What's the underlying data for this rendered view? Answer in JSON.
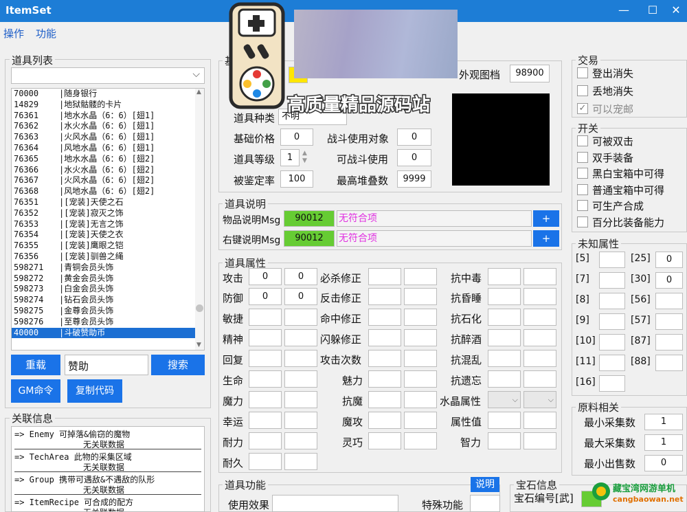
{
  "window": {
    "title": "ItemSet",
    "minimize": "—",
    "maximize": "☐",
    "close": "✕"
  },
  "menu": [
    "操作",
    "功能"
  ],
  "item_list": {
    "title": "道具列表",
    "items": [
      {
        "id": "70000",
        "name": "|随身银行"
      },
      {
        "id": "14829",
        "name": "|地狱骷髅的卡片"
      },
      {
        "id": "76361",
        "name": "|地水水晶（6：6）[翅1]"
      },
      {
        "id": "76362",
        "name": "|水火水晶（6：6）[翅1]"
      },
      {
        "id": "76363",
        "name": "|火风水晶（6：6）[翅1]"
      },
      {
        "id": "76364",
        "name": "|风地水晶（6：6）[翅1]"
      },
      {
        "id": "76365",
        "name": "|地水水晶（6：6）[翅2]"
      },
      {
        "id": "76366",
        "name": "|水火水晶（6：6）[翅2]"
      },
      {
        "id": "76367",
        "name": "|火风水晶（6：6）[翅2]"
      },
      {
        "id": "76368",
        "name": "|风地水晶（6：6）[翅2]"
      },
      {
        "id": "76351",
        "name": "|[宠装]天使之石"
      },
      {
        "id": "76352",
        "name": "|[宠装]寂灭之饰"
      },
      {
        "id": "76353",
        "name": "|[宠装]无言之饰"
      },
      {
        "id": "76354",
        "name": "|[宠装]天使之衣"
      },
      {
        "id": "76355",
        "name": "|[宠装]鹰眼之铠"
      },
      {
        "id": "76356",
        "name": "|[宠装]驯兽之绳"
      },
      {
        "id": "598271",
        "name": "|青铜会员头饰"
      },
      {
        "id": "598272",
        "name": "|黄金会员头饰"
      },
      {
        "id": "598273",
        "name": "|白金会员头饰"
      },
      {
        "id": "598274",
        "name": "|钻石会员头饰"
      },
      {
        "id": "598275",
        "name": "|金尊会员头饰"
      },
      {
        "id": "598276",
        "name": "|至尊会员头饰"
      },
      {
        "id": "40000",
        "name": "|斗破赞助币"
      }
    ],
    "reload": "重载",
    "search_value": "赞助",
    "search": "搜索",
    "gm": "GM命令",
    "copy": "复制代码"
  },
  "related": {
    "title": "关联信息",
    "rows": [
      {
        "a": "=> Enemy 可掉落&偷窃的魔物",
        "b": "无关联数据"
      },
      {
        "a": "=> TechArea 此物的采集区域",
        "b": "无关联数据"
      },
      {
        "a": "=> Group 携带可遇敌&不遇敌的队形",
        "b": "无关联数据"
      },
      {
        "a": "=> ItemRecipe 可合成的配方",
        "b": "无关联数据"
      }
    ]
  },
  "basic": {
    "partial_label": "基",
    "id_value": "4",
    "type_label": "道具种类",
    "type_value": "不明",
    "look_label": "外观图档",
    "look_value": "98900",
    "base_price_label": "基础价格",
    "base_price": "0",
    "battle_target_label": "战斗使用对象",
    "battle_target": "0",
    "level_label": "道具等级",
    "level": "1",
    "battle_use_label": "可战斗使用",
    "battle_use": "0",
    "appraise_label": "被鉴定率",
    "appraise": "100",
    "stack_label": "最高堆叠数",
    "stack": "9999"
  },
  "desc": {
    "title": "道具说明",
    "item_label": "物品说明Msg",
    "item_val": "90012",
    "item_text": "无符合项",
    "right_label": "右键说明Msg",
    "right_val": "90012",
    "right_text": "无符合项",
    "plus": "+"
  },
  "attrs": {
    "title": "道具属性",
    "col1": [
      {
        "l": "攻击",
        "a": "0",
        "b": "0"
      },
      {
        "l": "防御",
        "a": "0",
        "b": "0"
      },
      {
        "l": "敏捷",
        "a": "",
        "b": ""
      },
      {
        "l": "精神",
        "a": "",
        "b": ""
      },
      {
        "l": "回复",
        "a": "",
        "b": ""
      },
      {
        "l": "生命",
        "a": "",
        "b": ""
      },
      {
        "l": "魔力",
        "a": "",
        "b": ""
      },
      {
        "l": "幸运",
        "a": "",
        "b": ""
      },
      {
        "l": "耐力",
        "a": "",
        "b": ""
      },
      {
        "l": "耐久",
        "a": "",
        "b": ""
      }
    ],
    "col2": [
      "必杀修正",
      "反击修正",
      "命中修正",
      "闪躲修正",
      "攻击次数",
      "魅力",
      "抗魔",
      "魔攻",
      "灵巧"
    ],
    "col3": [
      "抗中毒",
      "抗昏睡",
      "抗石化",
      "抗醉酒",
      "抗混乱",
      "抗遗忘",
      "水晶属性",
      "属性值",
      "智力"
    ]
  },
  "func": {
    "title": "道具功能",
    "explain": "说明",
    "use_label": "使用效果",
    "special_label": "特殊功能"
  },
  "gem": {
    "title": "宝石信息",
    "id_label": "宝石编号[武]"
  },
  "trade": {
    "title": "交易",
    "items": [
      {
        "l": "登出消失",
        "c": false
      },
      {
        "l": "丢地消失",
        "c": false
      },
      {
        "l": "可以宠邮",
        "c": true
      }
    ]
  },
  "switch": {
    "title": "开关",
    "items": [
      "可被双击",
      "双手装备",
      "黑白宝箱中可得",
      "普通宝箱中可得",
      "可生产合成",
      "百分比装备能力"
    ]
  },
  "unknown": {
    "title": "未知属性",
    "left": [
      "[5]",
      "[7]",
      "[8]",
      "[9]",
      "[10]",
      "[11]",
      "[16]"
    ],
    "right": [
      {
        "l": "[25]",
        "v": "0"
      },
      {
        "l": "[30]",
        "v": "0"
      },
      {
        "l": "[56]",
        "v": ""
      },
      {
        "l": "[57]",
        "v": ""
      },
      {
        "l": "[87]",
        "v": ""
      },
      {
        "l": "[88]",
        "v": ""
      }
    ]
  },
  "material": {
    "title": "原料相关",
    "rows": [
      {
        "l": "最小采集数",
        "v": "1"
      },
      {
        "l": "最大采集数",
        "v": "1"
      },
      {
        "l": "最小出售数",
        "v": "0"
      }
    ]
  },
  "overlay": {
    "watermark": "高质量精品源码站",
    "corner_top": "藏宝湾网游单机",
    "corner_url": "cangbaowan.net"
  }
}
